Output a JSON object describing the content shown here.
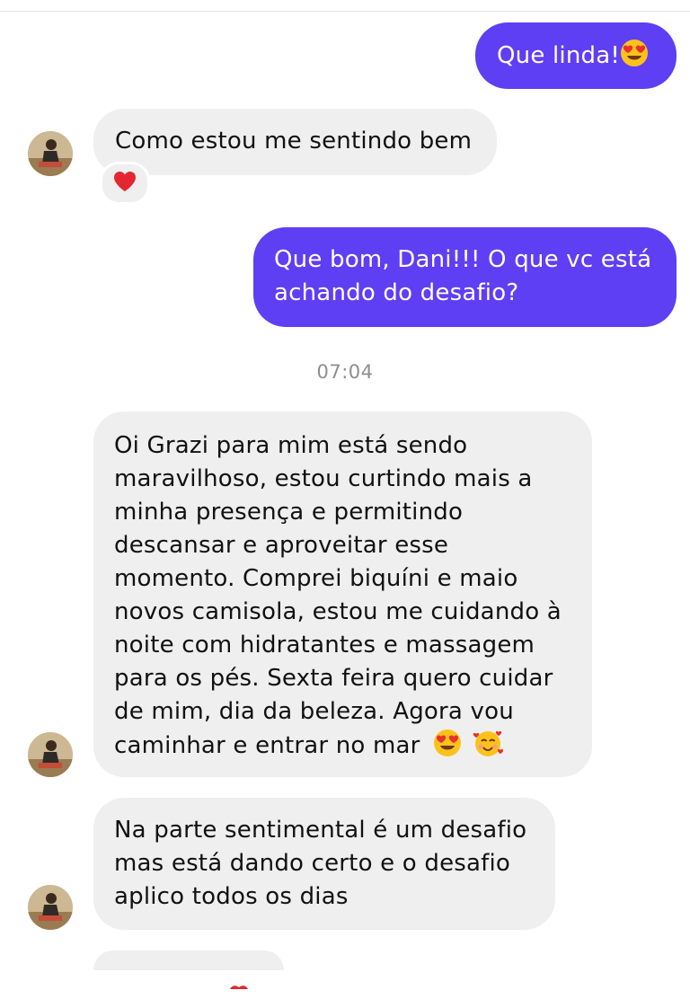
{
  "messages": [
    {
      "from": "me",
      "text": "Que linda!",
      "emoji": "heart-eyes"
    },
    {
      "from": "them",
      "text": "Como estou me sentindo bem",
      "reaction": "red-heart"
    },
    {
      "from": "me",
      "text": "Que bom, Dani!!! O que vc está\nachando do desafio?"
    },
    {
      "from": "system",
      "text": "07:04"
    },
    {
      "from": "them",
      "text": "Oi Grazi para mim está sendo\nmaravilhoso, estou curtindo mais a\nminha presença e permitindo\ndescansar e aproveitar esse\nmomento. Comprei biquíni e maio\nnovos camisola, estou me cuidando à\nnoite com hidratantes e massagem\npara os pés. Sexta feira quero cuidar\nde mim, dia da beleza. Agora vou\ncaminhar e entrar no mar",
      "emojis": [
        "heart-eyes",
        "smiling-face-with-hearts"
      ]
    },
    {
      "from": "them",
      "text": "Na parte sentimental é um desafio\nmas está dando certo e o desafio\naplico todos os dias"
    }
  ],
  "colors": {
    "outgoing": "#5e3ff3",
    "incoming": "#efefef",
    "timestamp": "#8e8e8e"
  }
}
